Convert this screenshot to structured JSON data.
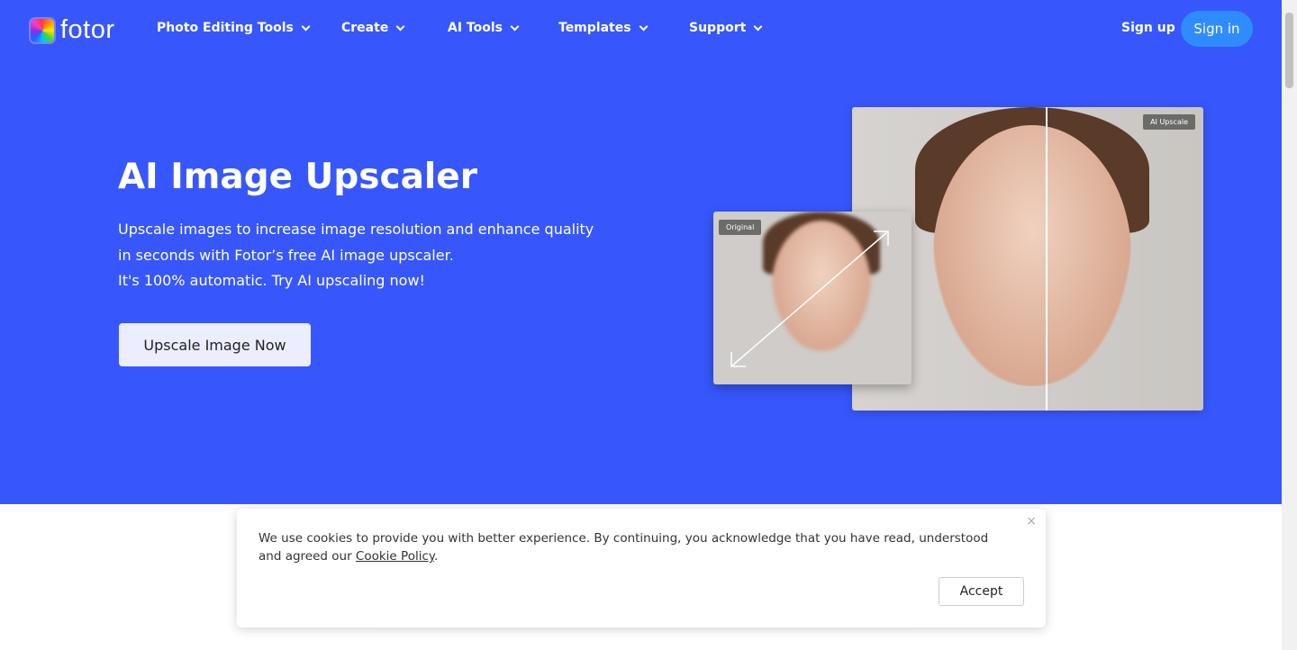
{
  "nav": {
    "brand": "fotor",
    "items": [
      "Photo Editing Tools",
      "Create",
      "AI Tools",
      "Templates",
      "Support"
    ],
    "sign_up": "Sign up",
    "sign_in": "Sign in"
  },
  "hero": {
    "title": "AI Image Upscaler",
    "description": [
      "Upscale images to increase image resolution and enhance quality",
      "in seconds with Fotor’s free AI image upscaler.",
      "It's 100% automatic. Try AI upscaling now!"
    ],
    "cta": "Upscale Image Now",
    "tag_original": "Original",
    "tag_upscale": "AI Upscale"
  },
  "cookie": {
    "text": "We use cookies to provide you with better experience. By continuing, you acknowledge that you have read, understood and agreed our ",
    "link": "Cookie Policy",
    "end": ".",
    "accept": "Accept",
    "close": "×"
  },
  "colors": {
    "hero_bg": "#3757fc",
    "sign_in_bg": "#2f8cff"
  }
}
